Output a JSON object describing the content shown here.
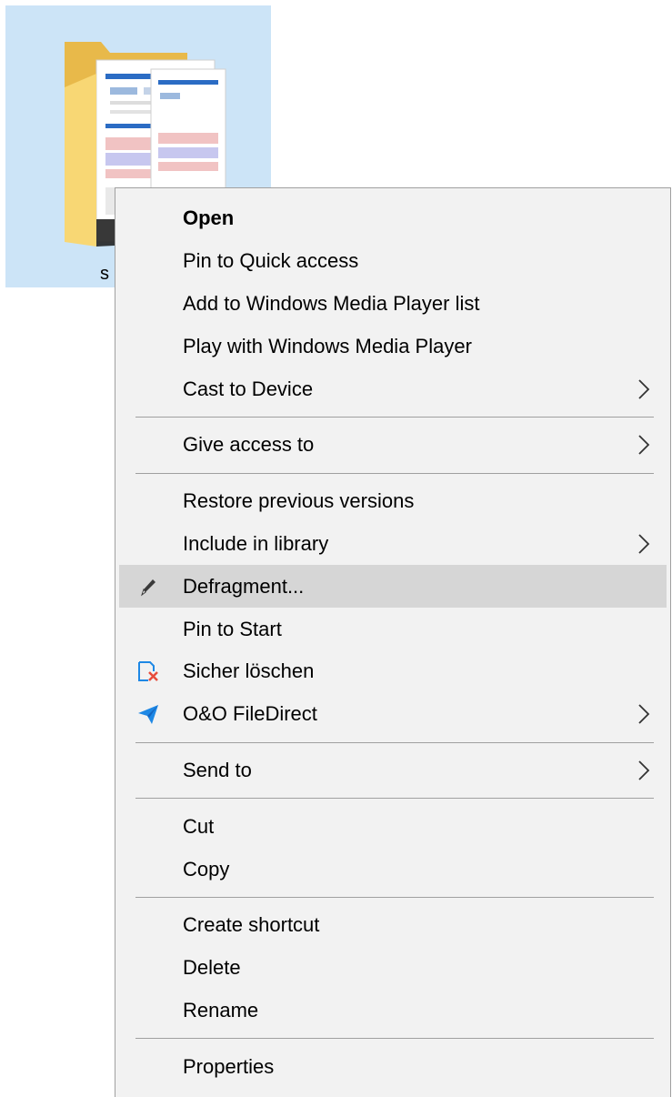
{
  "folder": {
    "label": "s",
    "icon": "folder-icon"
  },
  "menu": {
    "groups": [
      [
        {
          "label": "Open",
          "bold": true,
          "icon": null,
          "submenu": false
        },
        {
          "label": "Pin to Quick access",
          "bold": false,
          "icon": null,
          "submenu": false
        },
        {
          "label": "Add to Windows Media Player list",
          "bold": false,
          "icon": null,
          "submenu": false
        },
        {
          "label": "Play with Windows Media Player",
          "bold": false,
          "icon": null,
          "submenu": false
        },
        {
          "label": "Cast to Device",
          "bold": false,
          "icon": null,
          "submenu": true
        }
      ],
      [
        {
          "label": "Give access to",
          "bold": false,
          "icon": null,
          "submenu": true
        }
      ],
      [
        {
          "label": "Restore previous versions",
          "bold": false,
          "icon": null,
          "submenu": false
        },
        {
          "label": "Include in library",
          "bold": false,
          "icon": null,
          "submenu": true
        },
        {
          "label": "Defragment...",
          "bold": false,
          "icon": "defragment-icon",
          "submenu": false,
          "highlighted": true
        },
        {
          "label": "Pin to Start",
          "bold": false,
          "icon": null,
          "submenu": false
        },
        {
          "label": "Sicher löschen",
          "bold": false,
          "icon": "secure-delete-icon",
          "submenu": false
        },
        {
          "label": "O&O FileDirect",
          "bold": false,
          "icon": "paper-plane-icon",
          "submenu": true
        }
      ],
      [
        {
          "label": "Send to",
          "bold": false,
          "icon": null,
          "submenu": true
        }
      ],
      [
        {
          "label": "Cut",
          "bold": false,
          "icon": null,
          "submenu": false
        },
        {
          "label": "Copy",
          "bold": false,
          "icon": null,
          "submenu": false
        }
      ],
      [
        {
          "label": "Create shortcut",
          "bold": false,
          "icon": null,
          "submenu": false
        },
        {
          "label": "Delete",
          "bold": false,
          "icon": null,
          "submenu": false
        },
        {
          "label": "Rename",
          "bold": false,
          "icon": null,
          "submenu": false
        }
      ],
      [
        {
          "label": "Properties",
          "bold": false,
          "icon": null,
          "submenu": false
        }
      ]
    ]
  },
  "colors": {
    "menu_background": "#f2f2f2",
    "highlight": "#d6d6d6",
    "selection_tile": "#cce4f7",
    "separator": "#a0a0a0",
    "accent_blue": "#1e88e5"
  }
}
